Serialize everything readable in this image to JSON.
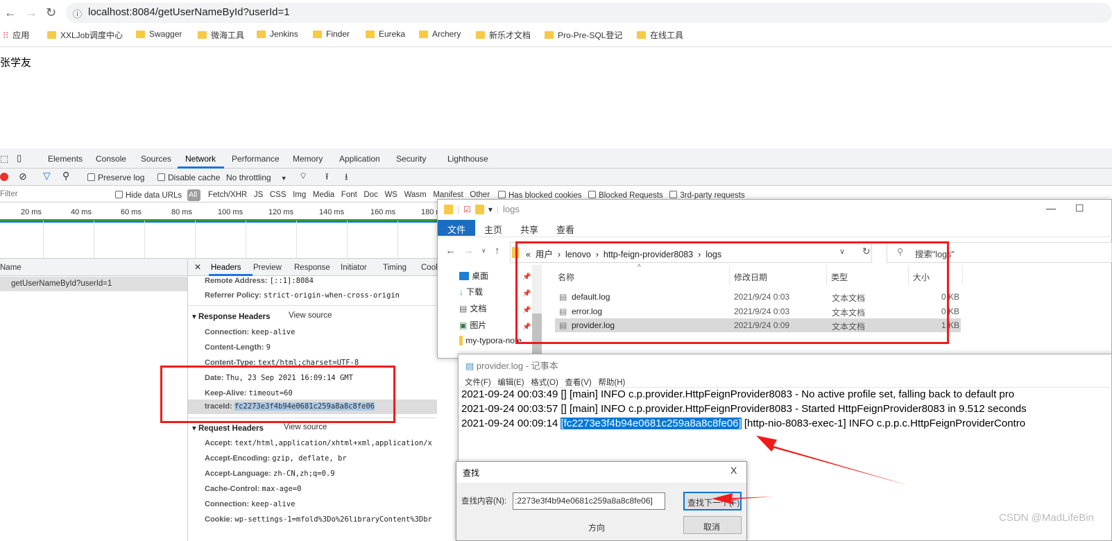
{
  "browser": {
    "url": "localhost:8084/getUserNameById?userId=1",
    "bookmarks": [
      "应用",
      "XXLJob调度中心",
      "Swagger",
      "微海工具",
      "Jenkins",
      "Finder",
      "Eureka",
      "Archery",
      "新乐才文档",
      "Pro-Pre-SQL登记",
      "在线工具"
    ]
  },
  "page": {
    "content": "张学友"
  },
  "devtools": {
    "tabs": [
      "Elements",
      "Console",
      "Sources",
      "Network",
      "Performance",
      "Memory",
      "Application",
      "Security",
      "Lighthouse"
    ],
    "active_tab": "Network",
    "toolbar": {
      "preserve_log": "Preserve log",
      "disable_cache": "Disable cache",
      "throttling": "No throttling"
    },
    "filter": {
      "placeholder": "Filter",
      "hide_data_urls": "Hide data URLs",
      "types": [
        "All",
        "Fetch/XHR",
        "JS",
        "CSS",
        "Img",
        "Media",
        "Font",
        "Doc",
        "WS",
        "Wasm",
        "Manifest",
        "Other"
      ],
      "has_blocked_cookies": "Has blocked cookies",
      "blocked_requests": "Blocked Requests",
      "third_party": "3rd-party requests"
    },
    "timeline_ticks": [
      "20 ms",
      "40 ms",
      "60 ms",
      "80 ms",
      "100 ms",
      "120 ms",
      "140 ms",
      "160 ms",
      "180 ms"
    ],
    "name_header": "Name",
    "request": "getUserNameById?userId=1",
    "detail_tabs": [
      "Headers",
      "Preview",
      "Response",
      "Initiator",
      "Timing",
      "Cookies"
    ],
    "general": [
      {
        "k": "Remote Address:",
        "v": "[::1]:8084"
      },
      {
        "k": "Referrer Policy:",
        "v": "strict-origin-when-cross-origin"
      }
    ],
    "response_headers_title": "Response Headers",
    "view_source": "View source",
    "response_headers": [
      {
        "k": "Connection:",
        "v": "keep-alive"
      },
      {
        "k": "Content-Length:",
        "v": "9"
      },
      {
        "k": "Content-Type:",
        "v": "text/html;charset=UTF-8"
      },
      {
        "k": "Date:",
        "v": "Thu, 23 Sep 2021 16:09:14 GMT"
      },
      {
        "k": "Keep-Alive:",
        "v": "timeout=60"
      },
      {
        "k": "traceId:",
        "v": "fc2273e3f4b94e0681c259a8a8c8fe06"
      }
    ],
    "request_headers_title": "Request Headers",
    "request_headers": [
      {
        "k": "Accept:",
        "v": "text/html,application/xhtml+xml,application/x"
      },
      {
        "k": "Accept-Encoding:",
        "v": "gzip, deflate, br"
      },
      {
        "k": "Accept-Language:",
        "v": "zh-CN,zh;q=0.9"
      },
      {
        "k": "Cache-Control:",
        "v": "max-age=0"
      },
      {
        "k": "Connection:",
        "v": "keep-alive"
      },
      {
        "k": "Cookie:",
        "v": "wp-settings-1=mfold%3Do%26libraryContent%3Dbr"
      }
    ]
  },
  "explorer": {
    "title": "logs",
    "ribbon": [
      "文件",
      "主页",
      "共享",
      "查看"
    ],
    "path": [
      "用户",
      "lenovo",
      "http-feign-provider8083",
      "logs"
    ],
    "search_placeholder": "搜索\"logs\"",
    "nav": [
      "桌面",
      "下载",
      "文档",
      "图片",
      "my-typora-note"
    ],
    "columns": [
      "名称",
      "修改日期",
      "类型",
      "大小"
    ],
    "files": [
      {
        "name": "default.log",
        "date": "2021/9/24 0:03",
        "type": "文本文档",
        "size": "0 KB"
      },
      {
        "name": "error.log",
        "date": "2021/9/24 0:03",
        "type": "文本文档",
        "size": "0 KB"
      },
      {
        "name": "provider.log",
        "date": "2021/9/24 0:09",
        "type": "文本文档",
        "size": "1 KB",
        "selected": true
      }
    ]
  },
  "notepad": {
    "title": "provider.log - 记事本",
    "menu": [
      "文件(F)",
      "编辑(E)",
      "格式(O)",
      "查看(V)",
      "帮助(H)"
    ],
    "lines": [
      {
        "pre": "2021-09-24 00:03:49 [] [main] INFO  c.p.provider.HttpFeignProvider8083 - No active profile set, falling back to default pro",
        "hl": "",
        "post": ""
      },
      {
        "pre": "2021-09-24 00:03:57 [] [main] INFO  c.p.provider.HttpFeignProvider8083 - Started HttpFeignProvider8083 in 9.512 seconds",
        "hl": "",
        "post": ""
      },
      {
        "pre": "2021-09-24 00:09:14 ",
        "hl": "[fc2273e3f4b94e0681c259a8a8c8fe06]",
        "post": " [http-nio-8083-exec-1] INFO  c.p.p.c.HttpFeignProviderContro"
      }
    ]
  },
  "find_dialog": {
    "title": "查找",
    "label": "查找内容(N):",
    "value": ":2273e3f4b94e0681c259a8a8c8fe06]",
    "find_next": "查找下一个(F)",
    "direction": "方向",
    "cancel": "取消",
    "close": "X"
  },
  "watermark": "CSDN @MadLifeBin",
  "colors": {
    "highlight": "#0078d7",
    "annotation": "#f21b1b",
    "explorer_file_tab": "#1a6dc0"
  }
}
